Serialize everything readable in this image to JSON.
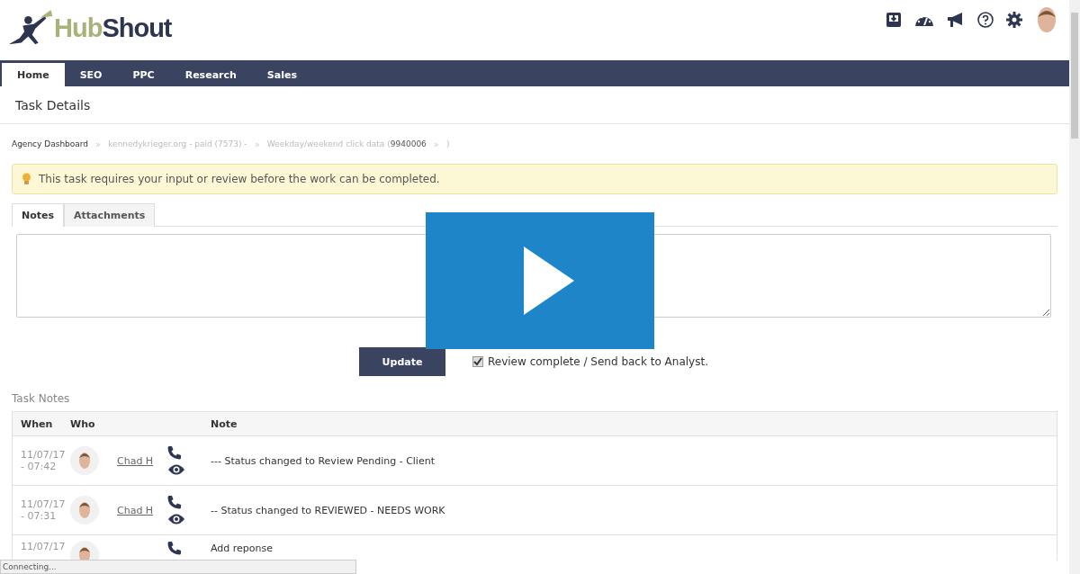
{
  "header": {
    "logo": {
      "part_1": "Hub",
      "part_2": "Shout"
    }
  },
  "nav": {
    "tabs": [
      {
        "label": "Home",
        "selected": true
      },
      {
        "label": "SEO",
        "selected": false
      },
      {
        "label": "PPC",
        "selected": false
      },
      {
        "label": "Research",
        "selected": false
      },
      {
        "label": "Sales",
        "selected": false
      }
    ]
  },
  "page_title": "Task Details",
  "breadcrumb": [
    {
      "label": "Agency Dashboard",
      "muted": false
    },
    {
      "separator": "»",
      "label": "kennedykrieger.org - paid (7573) -",
      "muted": true
    },
    {
      "separator": "»",
      "label": "Weekday/weekend click data (",
      "muted": true,
      "id": "9940006",
      "suffix_separator": "»",
      "suffix": ")"
    }
  ],
  "alert": {
    "text": "This task requires your input or review before the work can be completed."
  },
  "tabs": [
    {
      "label": "Notes",
      "selected": true
    },
    {
      "label": "Attachments",
      "selected": false
    }
  ],
  "video_overlay": {
    "kind": "play"
  },
  "update_button": "Update",
  "review_checkbox": {
    "label": "Review complete / Send back to Analyst.",
    "checked": true
  },
  "task_notes": {
    "title": "Task Notes",
    "columns": [
      "When",
      "Who",
      "Note"
    ],
    "rows": [
      {
        "when": "11/07/17 - 07:42",
        "who": "Chad H",
        "note": "--- Status changed to Review Pending - Client"
      },
      {
        "when": "11/07/17 - 07:31",
        "who": "Chad H",
        "note": "-- Status changed to REVIEWED - NEEDS WORK"
      },
      {
        "when": "11/07/17",
        "note": "Add reponse"
      }
    ]
  },
  "status_bar": "Connecting..."
}
